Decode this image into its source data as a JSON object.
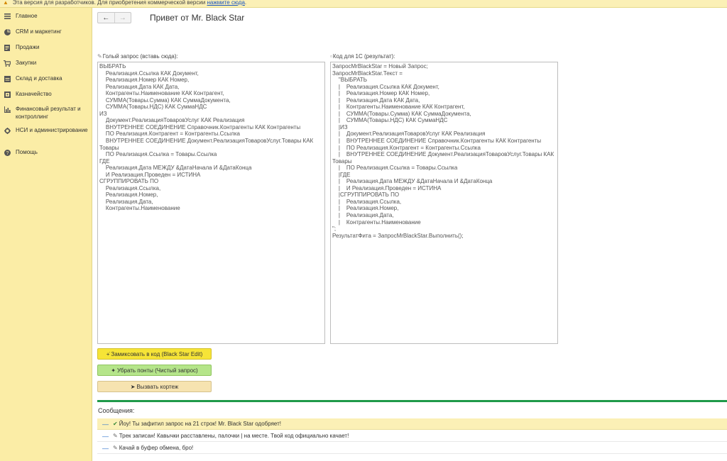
{
  "banner": {
    "text": "Эта версия для разработчиков. Для приобретения коммерческой версии ",
    "link": "нажмите сюда",
    "end": "."
  },
  "sidebar": {
    "items": [
      {
        "label": "Главное",
        "icon": "menu-icon"
      },
      {
        "label": "CRM и маркетинг",
        "icon": "pie-chart-icon"
      },
      {
        "label": "Продажи",
        "icon": "document-icon"
      },
      {
        "label": "Закупки",
        "icon": "cart-icon"
      },
      {
        "label": "Склад и доставка",
        "icon": "warehouse-icon"
      },
      {
        "label": "Казначейство",
        "icon": "bank-icon"
      },
      {
        "label": "Финансовый результат и контроллинг",
        "icon": "bar-chart-icon"
      },
      {
        "label": "НСИ и администрирование",
        "icon": "gear-icon"
      },
      {
        "label": "Помощь",
        "icon": "help-icon"
      }
    ]
  },
  "toolbar": {
    "back_icon": "←",
    "forward_icon": "→"
  },
  "page": {
    "title": "Привет от Mr. Black Star"
  },
  "left_field": {
    "label": "Голый запрос (вставь сюда):",
    "value": "ВЫБРАТЬ\n    Реализация.Ссылка КАК Документ,\n    Реализация.Номер КАК Номер,\n    Реализация.Дата КАК Дата,\n    Контрагенты.Наименование КАК Контрагент,\n    СУММА(Товары.Сумма) КАК СуммаДокумента,\n    СУММА(Товары.НДС) КАК СуммаНДС\nИЗ\n    Документ.РеализацияТоваровУслуг КАК Реализация\n    ВНУТРЕННЕЕ СОЕДИНЕНИЕ Справочник.Контрагенты КАК Контрагенты\n    ПО Реализация.Контрагент = Контрагенты.Ссылка\n    ВНУТРЕННЕЕ СОЕДИНЕНИЕ Документ.РеализацияТоваровУслуг.Товары КАК Товары\n    ПО Реализация.Ссылка = Товары.Ссылка\nГДЕ\n    Реализация.Дата МЕЖДУ &ДатаНачала И &ДатаКонца\n    И Реализация.Проведен = ИСТИНА\nСГРУППИРОВАТЬ ПО\n    Реализация.Ссылка,\n    Реализация.Номер,\n    Реализация.Дата,\n    Контрагенты.Наименование"
  },
  "right_field": {
    "label": "Код для 1С (результат):",
    "value": "ЗапросMrBlackStar = Новый Запрос;\nЗапросMrBlackStar.Текст =\n    \"ВЫБРАТЬ\n    |    Реализация.Ссылка КАК Документ,\n    |    Реализация.Номер КАК Номер,\n    |    Реализация.Дата КАК Дата,\n    |    Контрагенты.Наименование КАК Контрагент,\n    |    СУММА(Товары.Сумма) КАК СуммаДокумента,\n    |    СУММА(Товары.НДС) КАК СуммаНДС\n    |ИЗ\n    |    Документ.РеализацияТоваровУслуг КАК Реализация\n    |    ВНУТРЕННЕЕ СОЕДИНЕНИЕ Справочник.Контрагенты КАК Контрагенты\n    |    ПО Реализация.Контрагент = Контрагенты.Ссылка\n    |    ВНУТРЕННЕЕ СОЕДИНЕНИЕ Документ.РеализацияТоваровУслуг.Товары КАК Товары\n    |    ПО Реализация.Ссылка = Товары.Ссылка\n    |ГДЕ\n    |    Реализация.Дата МЕЖДУ &ДатаНачала И &ДатаКонца\n    |    И Реализация.Проведен = ИСТИНА\n    |СГРУППИРОВАТЬ ПО\n    |    Реализация.Ссылка,\n    |    Реализация.Номер,\n    |    Реализация.Дата,\n    |    Контрагенты.Наименование\n\";\nРезультатФита = ЗапросMrBlackStar.Выполнить();"
  },
  "actions": {
    "remix": "Замиксовать в код (Black Star Edit)",
    "clean": "Убрать понты (Чистый запрос)",
    "call": "Вызвать кортеж"
  },
  "messages": {
    "title": "Сообщения:",
    "items": [
      "Йоу! Ты зафитил запрос на 21 строк! Mr. Black Star одобряет!",
      "Трек записан! Кавычки расставлены, палочки | на месте. Твой код официально качает!",
      "Качай в буфер обмена, бро!"
    ]
  },
  "colors": {
    "sidebar_bg": "#fbeda6",
    "banner_bg": "#fbf0b6",
    "accent_green": "#1f9a4a",
    "btn_yellow": "#f6e437",
    "btn_green": "#b5e58a",
    "btn_beige": "#f6e3b0"
  }
}
